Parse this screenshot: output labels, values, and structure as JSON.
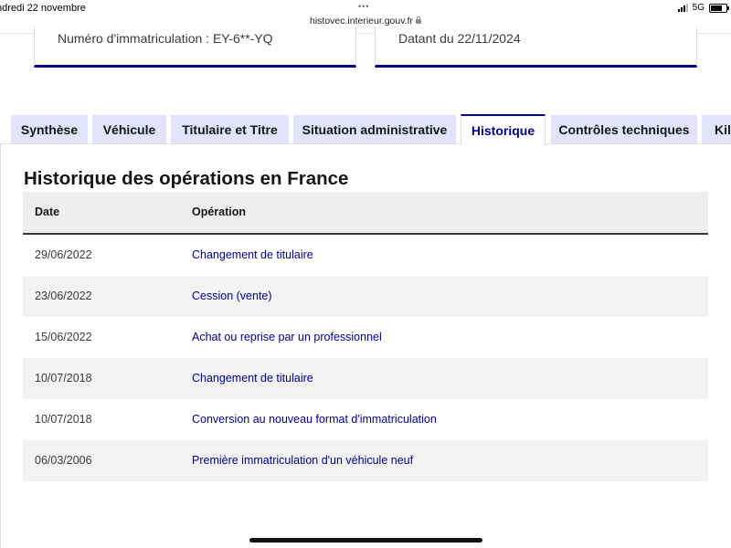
{
  "status_bar": {
    "date": "ndredi 22 novembre",
    "dots": "•••",
    "url": "histovec.interieur.gouv.fr",
    "network": "5G"
  },
  "cards": {
    "left_text": "Numéro d'immatriculation : EY-6**-YQ",
    "right_text": "Datant du 22/11/2024"
  },
  "tabs": [
    {
      "label": "Synthèse",
      "active": false
    },
    {
      "label": "Véhicule",
      "active": false
    },
    {
      "label": "Titulaire et Titre",
      "active": false
    },
    {
      "label": "Situation administrative",
      "active": false
    },
    {
      "label": "Historique",
      "active": true
    },
    {
      "label": "Contrôles techniques",
      "active": false
    },
    {
      "label": "Kil",
      "active": false
    }
  ],
  "history": {
    "title": "Historique des opérations en France",
    "columns": {
      "date": "Date",
      "operation": "Opération"
    },
    "rows": [
      {
        "date": "29/06/2022",
        "operation": "Changement de titulaire"
      },
      {
        "date": "23/06/2022",
        "operation": "Cession (vente)"
      },
      {
        "date": "15/06/2022",
        "operation": "Achat ou reprise par un professionnel"
      },
      {
        "date": "10/07/2018",
        "operation": "Changement de titulaire"
      },
      {
        "date": "10/07/2018",
        "operation": "Conversion au nouveau format d'immatriculation"
      },
      {
        "date": "06/03/2006",
        "operation": "Première immatriculation d'un véhicule neuf"
      }
    ]
  },
  "colors": {
    "accent": "#000091",
    "tab_bg": "#e3e3fd",
    "row_alt": "#f2f2f2",
    "header_bg": "#eeeeee"
  },
  "icons": [
    "lock-icon",
    "signal-icon",
    "battery-icon"
  ]
}
